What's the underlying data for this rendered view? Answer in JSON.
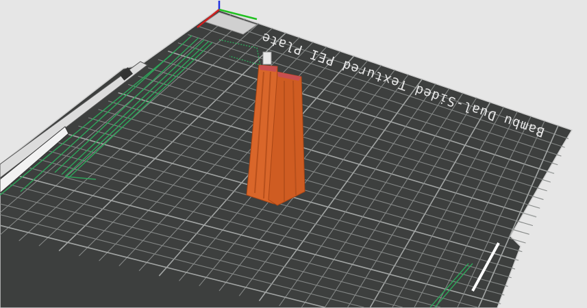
{
  "viewport": {
    "plate_label": "Bambu Dual-Sided Textured PEI Plate",
    "colors": {
      "background": "#e6e6e6",
      "plate": "#3d3f3e",
      "grid": "#8a8d8c",
      "toolpath": "#2fa35a",
      "model": "#d9662a",
      "axis_x": "#d02020",
      "axis_y": "#20c020",
      "axis_z": "#2030e0"
    }
  }
}
